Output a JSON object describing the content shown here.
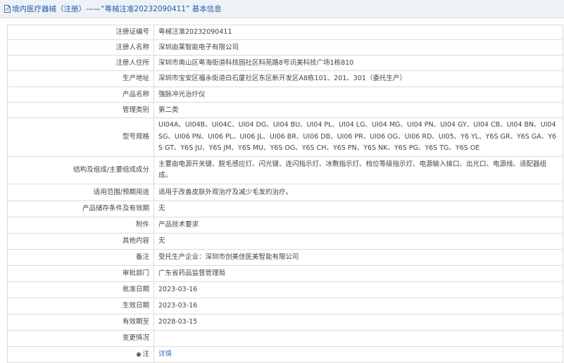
{
  "header": {
    "title": "境内医疗器械（注册）——“粤械注准20232090411” 基本信息",
    "icon": "document-icon"
  },
  "rows": [
    {
      "label": "注册证编号",
      "value": "粤械注准20232090411"
    },
    {
      "label": "注册人名称",
      "value": "深圳由莱智能电子有限公司"
    },
    {
      "label": "注册人住所",
      "value": "深圳市南山区粤海街道科技园社区科苑路8号讯美科技广场1栋810"
    },
    {
      "label": "生产地址",
      "value": "深圳市宝安区福永街道白石厦社区东区新开发区A8栋101、201、301（委托生产）"
    },
    {
      "label": "产品名称",
      "value": "强脉冲光治疗仪"
    },
    {
      "label": "管理类别",
      "value": "第二类"
    },
    {
      "label": "型号规格",
      "value": "UI04A、UI04B、UI04C、UI04 DG、UI04 BU、UI04 PL、UI04 LG、UI04 MG、UI04 PN、UI04 GY、UI04 CB、UI04 BN、UI04 SG、UI06 PN、UI06 PL、UI06 JL、UI06 BR、UI06 DB、UI06 PR、UI06 OG、UI06 RD、UI05、Y6 YL、Y6S GR、Y6S GA、Y6S GT、Y6S JU、Y6S JM、Y6S MU、Y6S OG、Y6S CH、Y6S PN、Y6S NK、Y6S PG、Y6S TG、Y6S OE"
    },
    {
      "label": "结构及组成/主要组成成分",
      "value": "主要由电源开关键、脱毛感应灯、闪光键、连闪指示灯、冰敷指示灯、档位等级指示灯、电源输入接口、出光口、电源线、适配器组成。"
    },
    {
      "label": "适用范围/预期用途",
      "value": "适用于改善皮肤外观治疗及减少毛发的治疗。"
    },
    {
      "label": "产品储存条件及有效期",
      "value": "无"
    },
    {
      "label": "附件",
      "value": "产品技术要求"
    },
    {
      "label": "其他内容",
      "value": "无"
    },
    {
      "label": "备注",
      "value": "受托生产企业：深圳市创美佳医美智能有限公司"
    },
    {
      "label": "审批部门",
      "value": "广东省药品监督管理局"
    },
    {
      "label": "批准日期",
      "value": "2023-03-16"
    },
    {
      "label": "生效日期",
      "value": "2023-03-16"
    },
    {
      "label": "有效期至",
      "value": "2028-03-15"
    },
    {
      "label": "变更情况",
      "value": ""
    },
    {
      "label": "注",
      "value": "详情",
      "icon": "pin-icon"
    }
  ]
}
